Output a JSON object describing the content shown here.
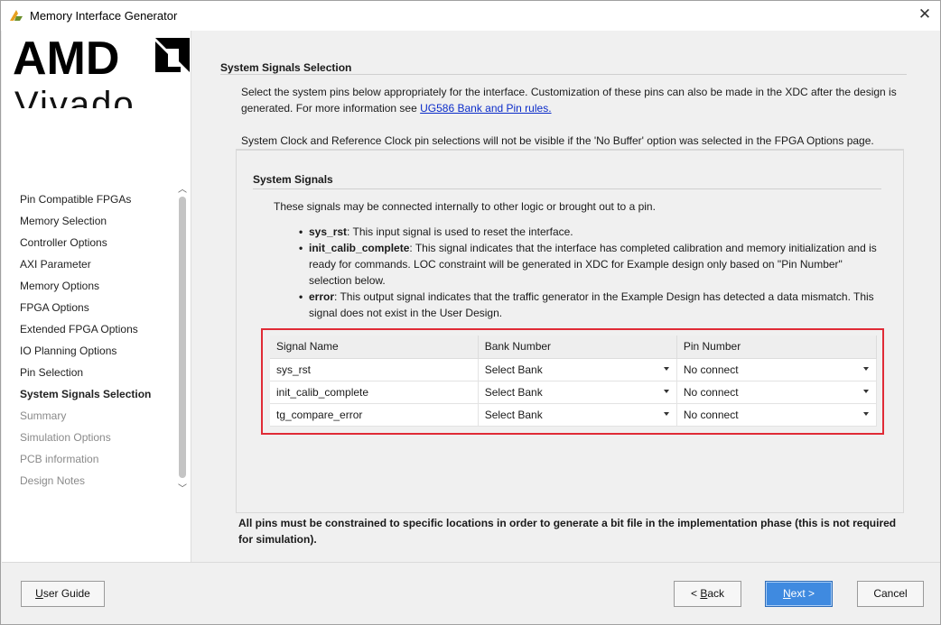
{
  "window": {
    "title": "Memory Interface Generator",
    "close_glyph": "✕"
  },
  "logo": {
    "brand": "AMD",
    "product": "Vivado"
  },
  "nav": {
    "items": [
      {
        "label": "Pin Compatible FPGAs",
        "state": "normal"
      },
      {
        "label": "Memory Selection",
        "state": "normal"
      },
      {
        "label": "Controller Options",
        "state": "normal"
      },
      {
        "label": "AXI Parameter",
        "state": "normal"
      },
      {
        "label": "Memory Options",
        "state": "normal"
      },
      {
        "label": "FPGA Options",
        "state": "normal"
      },
      {
        "label": "Extended FPGA Options",
        "state": "normal"
      },
      {
        "label": "IO Planning Options",
        "state": "normal"
      },
      {
        "label": "Pin Selection",
        "state": "normal"
      },
      {
        "label": "System Signals Selection",
        "state": "active"
      },
      {
        "label": "Summary",
        "state": "disabled"
      },
      {
        "label": "Simulation Options",
        "state": "disabled"
      },
      {
        "label": "PCB information",
        "state": "disabled"
      },
      {
        "label": "Design Notes",
        "state": "disabled"
      }
    ]
  },
  "page": {
    "section_title": "System Signals Selection",
    "intro_text": "Select the system pins below appropriately for the interface. Customization of these pins can also be made in the XDC after the design is generated. For more information see ",
    "intro_link": "UG586 Bank and Pin rules.",
    "note": "System Clock and Reference Clock pin selections will not be visible if the 'No Buffer' option was selected in the FPGA Options page.",
    "signals": {
      "title": "System Signals",
      "description": "These signals may be connected internally to other logic or brought out to a pin.",
      "bullets": [
        {
          "name": "sys_rst",
          "text": ": This input signal is used to reset the interface."
        },
        {
          "name": "init_calib_complete",
          "text": ": This signal indicates that the interface has completed calibration and memory initialization and is ready for commands. LOC constraint will be generated in XDC for Example design only based on \"Pin Number\" selection below."
        },
        {
          "name": "error",
          "text": ": This output signal indicates that the traffic generator in the Example Design has detected a data mismatch. This signal does not exist in the User Design."
        }
      ]
    },
    "table": {
      "headers": [
        "Signal Name",
        "Bank Number",
        "Pin Number"
      ],
      "rows": [
        {
          "signal": "sys_rst",
          "bank": "Select Bank",
          "pin": "No connect"
        },
        {
          "signal": "init_calib_complete",
          "bank": "Select Bank",
          "pin": "No connect"
        },
        {
          "signal": "tg_compare_error",
          "bank": "Select Bank",
          "pin": "No connect"
        }
      ]
    },
    "footer_warning": "All pins must be constrained to specific locations in order to generate a bit file in the implementation phase (this is not required for simulation)."
  },
  "buttons": {
    "user_guide": {
      "accel": "U",
      "rest": "ser Guide"
    },
    "back": {
      "prefix": "< ",
      "accel": "B",
      "rest": "ack"
    },
    "next": {
      "accel": "N",
      "rest": "ext >"
    },
    "cancel": "Cancel"
  },
  "colors": {
    "highlight_border": "#e02b36",
    "primary_button": "#3f8ae0",
    "link": "#0b2cc9"
  }
}
